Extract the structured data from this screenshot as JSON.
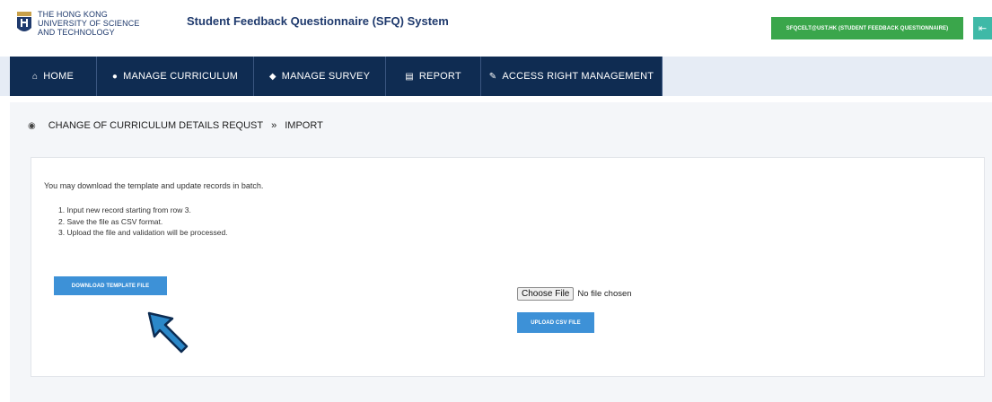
{
  "header": {
    "university_lines": [
      "THE HONG KONG",
      "UNIVERSITY OF SCIENCE",
      "AND TECHNOLOGY"
    ],
    "system_title": "Student Feedback Questionnaire (SFQ) System",
    "user_badge": "SFQCELT@UST.HK (STUDENT FEEDBACK QUESTIONNAIRE)",
    "logout_icon": "logout-icon"
  },
  "nav": {
    "items": [
      {
        "label": "HOME",
        "icon": "home-icon",
        "glyph": "⌂"
      },
      {
        "label": "MANAGE CURRICULUM",
        "icon": "comment-icon",
        "glyph": "●"
      },
      {
        "label": "MANAGE SURVEY",
        "icon": "cube-icon",
        "glyph": "◆"
      },
      {
        "label": "REPORT",
        "icon": "report-icon",
        "glyph": "▤"
      },
      {
        "label": "ACCESS RIGHT MANAGEMENT",
        "icon": "pencil-icon",
        "glyph": "✎"
      }
    ]
  },
  "breadcrumb": {
    "home_icon": "dashboard-icon",
    "items": [
      "CHANGE OF CURRICULUM DETAILS REQUST",
      "IMPORT"
    ],
    "separator": "»"
  },
  "content": {
    "intro": "You may download the template and update records in batch.",
    "steps": [
      "1. Input new record starting from row 3.",
      "2. Save the file as CSV format.",
      "3. Upload the file and validation will be processed."
    ],
    "download_button": "DOWNLOAD TEMPLATE FILE",
    "choose_file_button": "Choose File",
    "no_file_text": "No file chosen",
    "upload_button": "UPLOAD CSV FILE"
  },
  "colors": {
    "nav_bg": "#0f2c52",
    "button_blue": "#3d91d7",
    "badge_green": "#3aa64b",
    "arrow_blue": "#2b88c9"
  }
}
